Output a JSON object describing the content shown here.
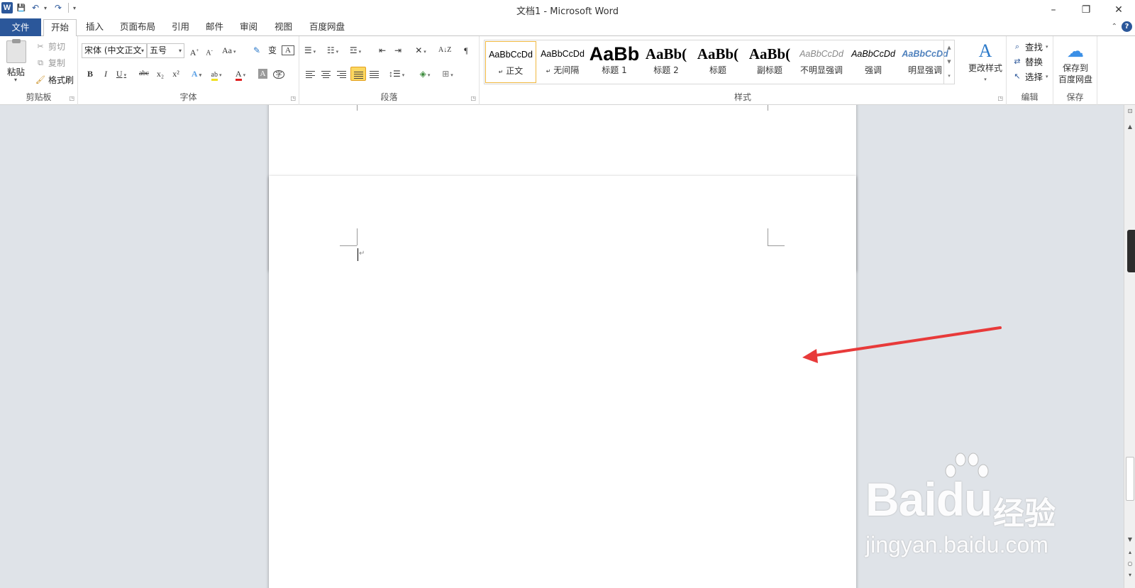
{
  "window": {
    "title": "文档1 - Microsoft Word",
    "app_icon": "W",
    "minimize": "–",
    "restore": "❐",
    "close": "✕"
  },
  "qat": {
    "save": "💾",
    "undo": "↶",
    "redo": "↷",
    "customize": "▾"
  },
  "tabs": [
    "文件",
    "开始",
    "插入",
    "页面布局",
    "引用",
    "邮件",
    "审阅",
    "视图",
    "百度网盘"
  ],
  "active_tab": "开始",
  "ribbon": {
    "clipboard": {
      "paste": "粘贴",
      "cut": "剪切",
      "copy": "复制",
      "format_painter": "格式刷",
      "group": "剪贴板"
    },
    "font": {
      "font_name": "宋体 (中文正文",
      "font_size": "五号",
      "group": "字体",
      "buttons": {
        "grow": "A",
        "shrink": "A",
        "case": "Aa",
        "clear": "A",
        "bold": "B",
        "italic": "I",
        "underline": "U",
        "strike": "abc",
        "sub": "x₂",
        "sup": "x²",
        "highlight": "ab",
        "color": "A",
        "shade": "A",
        "enclose": "字"
      }
    },
    "paragraph": {
      "group": "段落",
      "sort": "A↓Z",
      "show_marks": "¶"
    },
    "styles": {
      "group": "样式",
      "items": [
        {
          "preview": "AaBbCcDd",
          "name": "正文",
          "prefix": "↵"
        },
        {
          "preview": "AaBbCcDd",
          "name": "无间隔",
          "prefix": "↵"
        },
        {
          "preview": "AaBb",
          "name": "标题 1",
          "prefix": ""
        },
        {
          "preview": "AaBb(",
          "name": "标题 2",
          "prefix": ""
        },
        {
          "preview": "AaBb(",
          "name": "标题",
          "prefix": ""
        },
        {
          "preview": "AaBb(",
          "name": "副标题",
          "prefix": ""
        },
        {
          "preview": "AaBbCcDd",
          "name": "不明显强调",
          "prefix": ""
        },
        {
          "preview": "AaBbCcDd",
          "name": "强调",
          "prefix": ""
        },
        {
          "preview": "AaBbCcDd",
          "name": "明显强调",
          "prefix": ""
        }
      ],
      "change_styles": "更改样式"
    },
    "editing": {
      "group": "编辑",
      "find": "查找",
      "replace": "替换",
      "select": "选择"
    },
    "save_group": {
      "group": "保存",
      "button_line1": "保存到",
      "button_line2": "百度网盘"
    }
  },
  "colors": {
    "accent": "#2b579a",
    "arrow": "#e83a3a",
    "doc_bg": "#dfe3e8"
  },
  "watermark": {
    "main": "Bai",
    "du": "du",
    "cn": "经验",
    "url": "jingyan.baidu.com"
  }
}
